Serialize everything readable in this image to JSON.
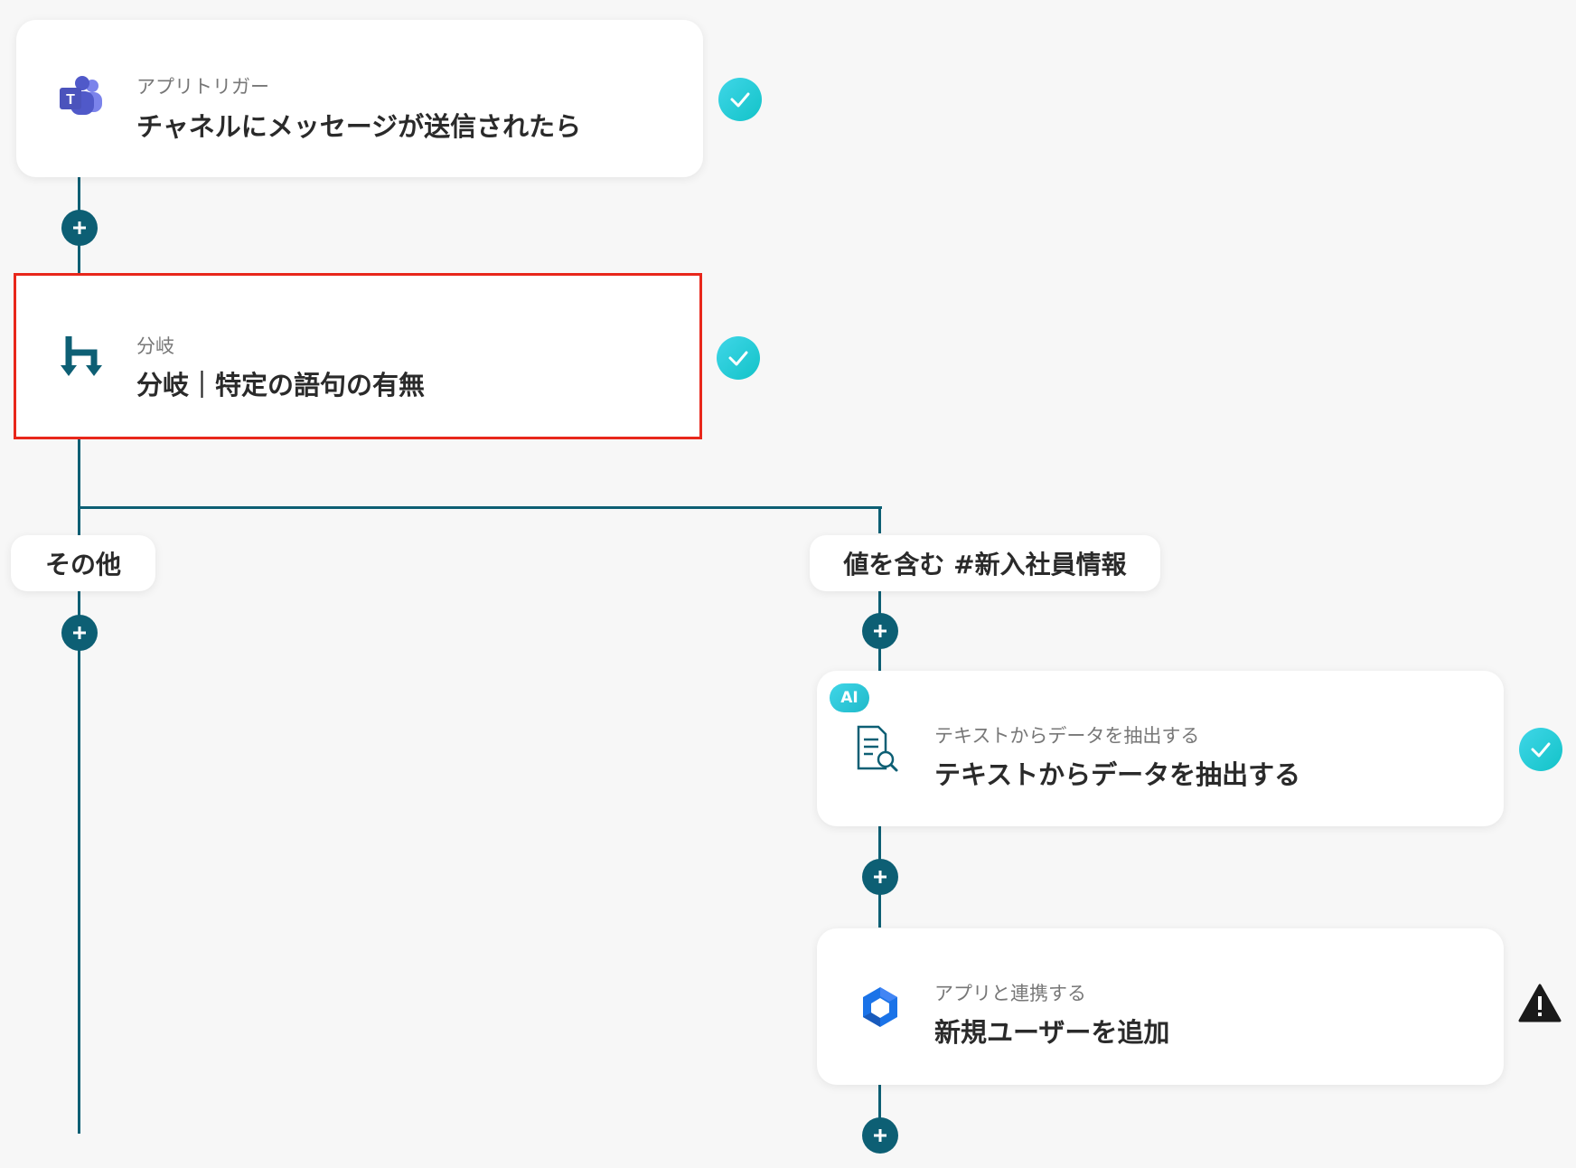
{
  "steps": [
    {
      "subtitle": "アプリトリガー",
      "title": "チャネルにメッセージが送信されたら",
      "icon": "microsoft-teams-icon",
      "status": "complete"
    },
    {
      "subtitle": "分岐",
      "title": "分岐｜特定の語句の有無",
      "icon": "branch-icon",
      "status": "complete"
    },
    {
      "subtitle": "テキストからデータを抽出する",
      "title": "テキストからデータを抽出する",
      "icon": "document-search-icon",
      "badge": "AI",
      "status": "complete"
    },
    {
      "subtitle": "アプリと連携する",
      "title": "新規ユーザーを追加",
      "icon": "google-workspace-icon",
      "status": "warning"
    }
  ],
  "branches": {
    "other_label": "その他",
    "match_label": "値を含む #新入社員情報"
  },
  "colors": {
    "connector": "#0d5f74",
    "check": "#1fc7d2",
    "selected_border": "#e8271b"
  }
}
